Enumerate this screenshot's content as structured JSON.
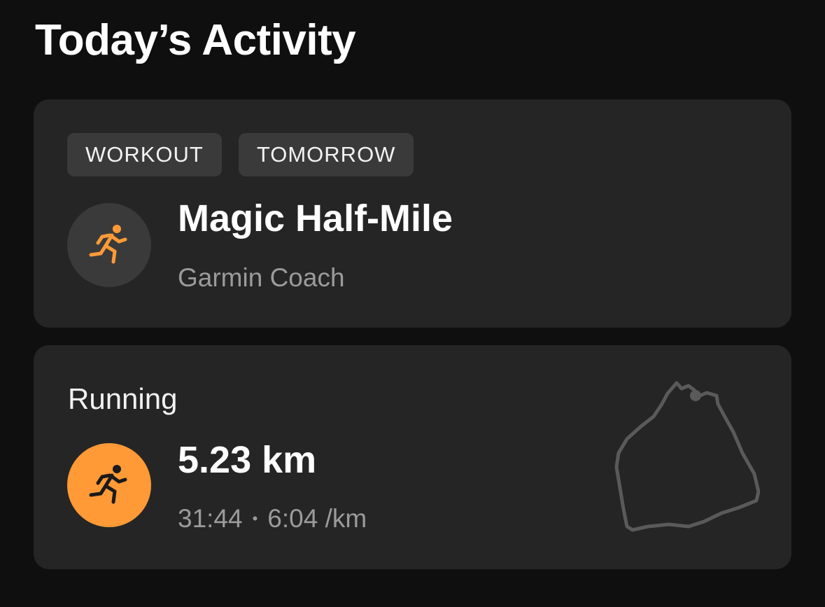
{
  "page": {
    "title": "Today’s Activity"
  },
  "workout_card": {
    "tags": [
      "WORKOUT",
      "TOMORROW"
    ],
    "icon": "running-person-icon",
    "title": "Magic Half-Mile",
    "subtitle": "Garmin Coach"
  },
  "running_card": {
    "activity_type": "Running",
    "icon": "running-person-icon",
    "distance": "5.23 km",
    "duration": "31:44",
    "separator": "•",
    "pace": "6:04 /km",
    "route_icon": "route-map-icon"
  },
  "colors": {
    "background": "#0f0f0f",
    "card": "#252525",
    "tag": "#3a3a3a",
    "accent": "#ff9a36",
    "secondary_text": "#9b9b9b"
  }
}
